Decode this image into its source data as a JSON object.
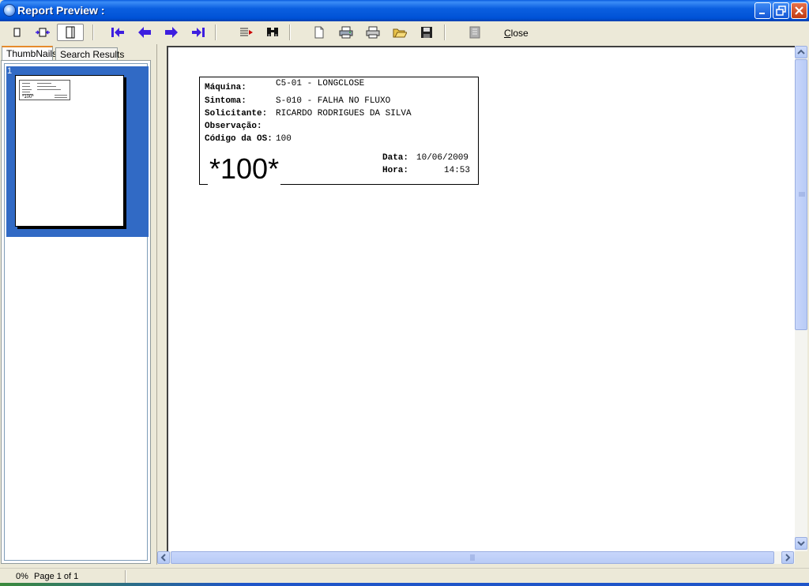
{
  "window": {
    "title": "Report Preview :"
  },
  "toolbar": {
    "close_label_underlined": "C",
    "close_label_rest": "lose",
    "icons": [
      "page-width-icon",
      "two-page-icon",
      "full-page-icon",
      "first-page-icon",
      "prev-page-icon",
      "next-page-icon",
      "last-page-icon",
      "go-to-page-icon",
      "find-icon",
      "page-setup-icon",
      "printer-setup-icon",
      "print-icon",
      "open-icon",
      "save-icon",
      "export-icon"
    ]
  },
  "tabs": {
    "thumbnails": "ThumbNails",
    "search_results": "Search Results"
  },
  "thumbnails": [
    {
      "number": "1",
      "barcode": "*100*"
    }
  ],
  "report": {
    "labels": {
      "maquina": "Máquina:",
      "sintoma": "Sintoma:",
      "solicitante": "Solicitante:",
      "observacao": "Observação:",
      "codigo": "Código da OS:",
      "data": "Data:",
      "hora": "Hora:"
    },
    "values": {
      "maquina": "C5-01 - LONGCLOSE",
      "sintoma": "S-010 - FALHA NO FLUXO",
      "solicitante": "RICARDO RODRIGUES DA SILVA",
      "codigo": "100",
      "data": "10/06/2009",
      "hora": "14:53"
    },
    "barcode": "*100*"
  },
  "status": {
    "progress": "0%",
    "page": "Page 1 of 1"
  },
  "colors": {
    "titlebar": "#0052d6",
    "selection": "#316ac5",
    "nav_arrows": "#3d1ee0"
  }
}
